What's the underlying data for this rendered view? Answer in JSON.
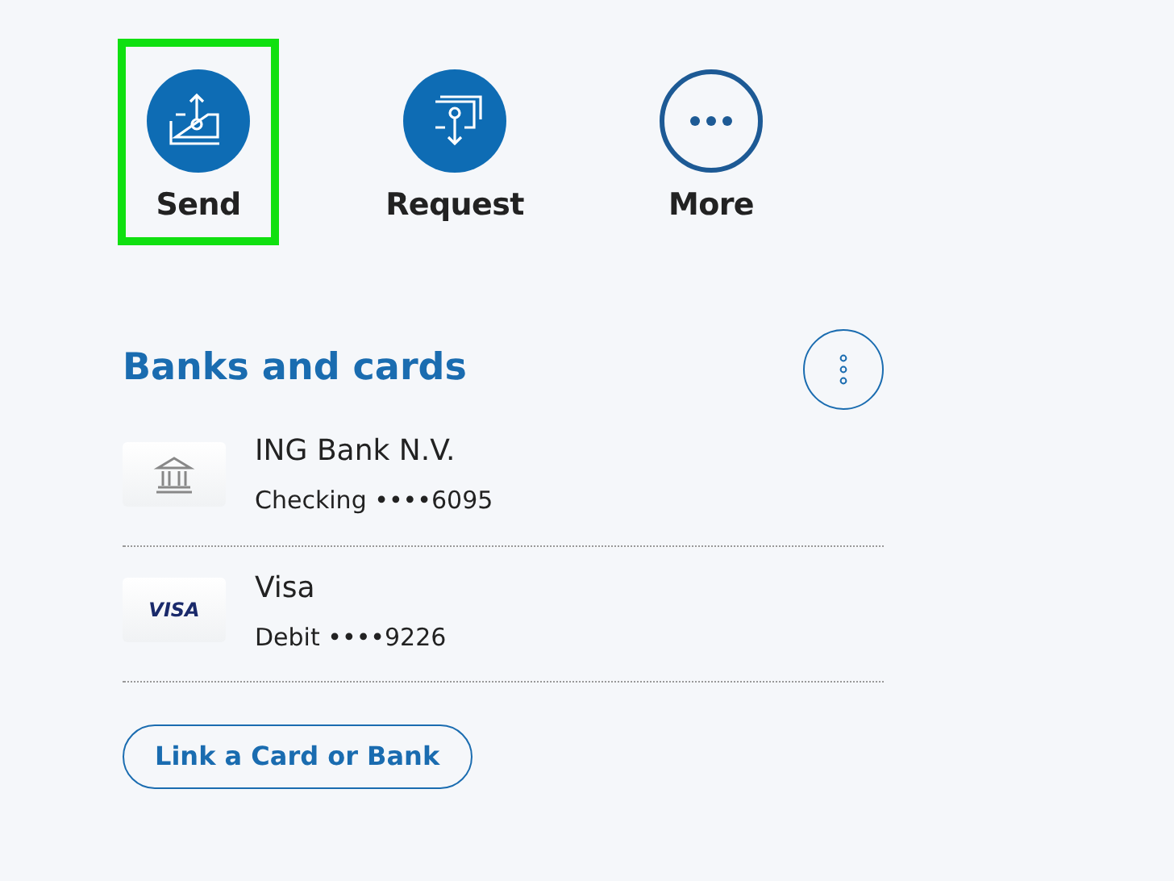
{
  "actions": [
    {
      "kind": "send",
      "label": "Send",
      "highlighted": true
    },
    {
      "kind": "request",
      "label": "Request",
      "highlighted": false
    },
    {
      "kind": "more",
      "label": "More",
      "highlighted": false
    }
  ],
  "banks_and_cards": {
    "title": "Banks and cards",
    "items": [
      {
        "kind": "bank",
        "name": "ING Bank N.V.",
        "detail": "Checking ••••6095"
      },
      {
        "kind": "card",
        "logo_text": "VISA",
        "name": "Visa",
        "detail": "Debit ••••9226"
      }
    ],
    "link_button": "Link a Card or Bank"
  }
}
